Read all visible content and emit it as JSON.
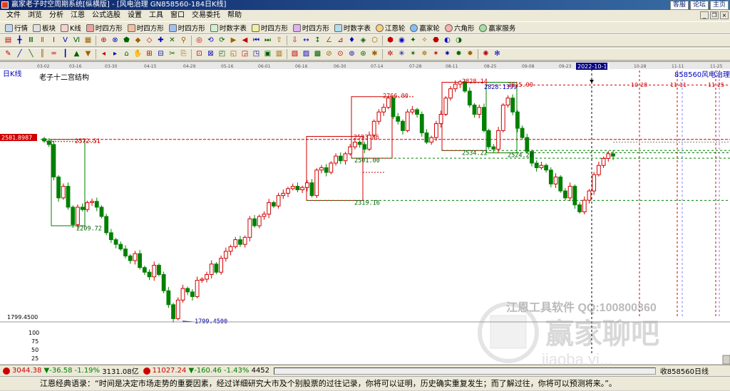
{
  "window": {
    "title": "赢家老子时空周期系统[纵横版] - [风电治理  GN858560-184日K线]",
    "links": [
      "客服",
      "论坛",
      "主页"
    ]
  },
  "menu": [
    "文件",
    "浏览",
    "分析",
    "江恩",
    "公式选股",
    "设置",
    "工具",
    "窗口",
    "交易委托",
    "帮助"
  ],
  "toolbar1": [
    "行情",
    "板块",
    "K线",
    "时四方形",
    "时四方形",
    "时四方形",
    "时数字表",
    "时四方形",
    "时四方形",
    "时数字表",
    "江恩轮",
    "赢家轮",
    "六角形",
    "赢家服务"
  ],
  "chart": {
    "period_label": "日K线",
    "study_title": "老子十二宫结构",
    "code_label": "858560",
    "name_label": "风电治理",
    "cursor_date": "2022-10-11",
    "left_price_tag": "2581.8987",
    "scale_low_label": "1799.4500",
    "y_axis_ticks": [
      "100",
      "75",
      "50",
      "25"
    ],
    "top_dates": [
      "03-02",
      "03-16",
      "03-30",
      "04-15",
      "04-29",
      "05-16",
      "06-01",
      "06-16",
      "06-30",
      "07-14",
      "07-28",
      "08-11",
      "08-25",
      "09-08",
      "09-23",
      "2022-10-11",
      "10-28",
      "11-11",
      "11-25"
    ],
    "future_date_labels": [
      "10-28",
      "11-11",
      "11-25"
    ],
    "price_labels": [
      {
        "text": "2572.51",
        "color": "#d00000"
      },
      {
        "text": "2209.72",
        "color": "#006000"
      },
      {
        "text": "1799.4500",
        "color": "#0000a0"
      },
      {
        "text": "2319.16",
        "color": "#006000"
      },
      {
        "text": "2593.86",
        "color": "#d00000"
      },
      {
        "text": "2501.00",
        "color": "#006000"
      },
      {
        "text": "2766.00",
        "color": "#d00000"
      },
      {
        "text": "2534.22",
        "color": "#006000"
      },
      {
        "text": "2828.14",
        "color": "#d00000"
      },
      {
        "text": "2828.1399",
        "color": "#0000a0"
      },
      {
        "text": "2524.20",
        "color": "#006000"
      },
      {
        "text": "2815.99",
        "color": "#d00000"
      }
    ],
    "watermark_top": "江恩工具软件  QQ:100800360",
    "watermark_main": "赢家聊吧",
    "watermark_sub": "jiaoba.yi..."
  },
  "status": {
    "sh_value": "3044.38",
    "sh_change": "▼-36.58",
    "sh_pct": "-1.19%",
    "sh_amount": "3131.08亿",
    "sz_value": "11027.24",
    "sz_change": "▼-160.46",
    "sz_pct": "-1.43%",
    "sz_amount": "4452",
    "right_text": "收858560日线"
  },
  "quote": "江恩经典语录：“时间是决定市场走势的重要因素，经过详细研究大市及个别股票的过往记录，你将可以证明，历史确实重复发生；而了解过往，你将可以预测将来。”。"
}
